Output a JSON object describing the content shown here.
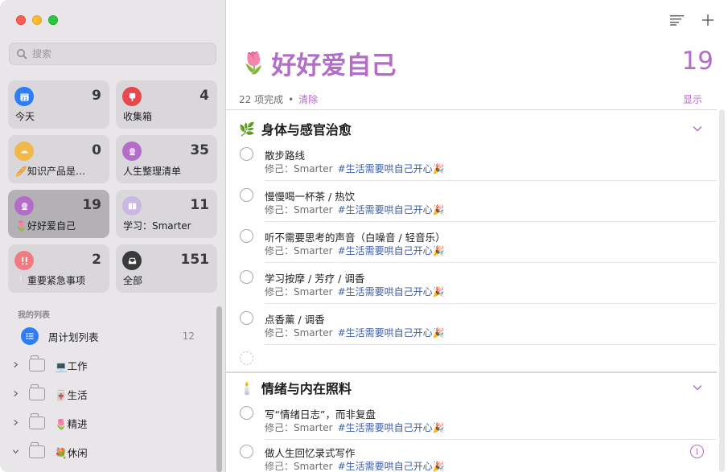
{
  "sidebar": {
    "search_placeholder": "搜索",
    "tiles": [
      {
        "label": "今天",
        "count": "9",
        "icon": "calendar-icon",
        "color": "#2f7df6",
        "glyph": "21"
      },
      {
        "label": "收集箱",
        "count": "4",
        "icon": "inbox-icon",
        "color": "#e5484d",
        "glyph": "📮"
      },
      {
        "label": "🥖知识产品是…",
        "count": "0",
        "icon": "bread-icon",
        "color": "#f0b84a",
        "glyph": "🥐"
      },
      {
        "label": "人生整理清单",
        "count": "35",
        "icon": "crystal-ball-icon",
        "color": "#b46cc9",
        "glyph": "🔮"
      },
      {
        "label": "🌷好好爱自己",
        "count": "19",
        "icon": "crystal-ball-icon",
        "color": "#b46cc9",
        "glyph": "🔮"
      },
      {
        "label": "学习：Smarter",
        "count": "11",
        "icon": "book-icon",
        "color": "#c9b8e6",
        "glyph": "📖"
      },
      {
        "label": "❕重要紧急事项",
        "count": "2",
        "icon": "exclamation-icon",
        "color": "#f27a83",
        "glyph": "‼"
      },
      {
        "label": "全部",
        "count": "151",
        "icon": "tray-icon",
        "color": "#3a3a3c",
        "glyph": "⌂"
      }
    ],
    "section_title": "我的列表",
    "lists": [
      {
        "name": "周计划列表",
        "count": "12"
      },
      {
        "name": "💻工作"
      },
      {
        "name": "🀄生活"
      },
      {
        "name": "🌷精进"
      },
      {
        "name": "💐休闲"
      }
    ]
  },
  "main": {
    "title_emoji": "🌷",
    "title": "好好爱自己",
    "count": "19",
    "completed": "22 项完成",
    "dot": "•",
    "clear": "清除",
    "show": "显示",
    "groups": [
      {
        "emoji": "🌿",
        "title": "身体与感官治愈",
        "tasks": [
          {
            "title": "散步路线",
            "note": "修己：Smarter",
            "tag": "#生活需要哄自己开心🎉"
          },
          {
            "title": "慢慢喝一杯茶 / 热饮",
            "note": "修己：Smarter",
            "tag": "#生活需要哄自己开心🎉"
          },
          {
            "title": "听不需要思考的声音（白噪音 / 轻音乐）",
            "note": "修己：Smarter",
            "tag": "#生活需要哄自己开心🎉"
          },
          {
            "title": "学习按摩 / 芳疗 / 调香",
            "note": "修己：Smarter",
            "tag": "#生活需要哄自己开心🎉"
          },
          {
            "title": "点香薰 / 调香",
            "note": "修己：Smarter",
            "tag": "#生活需要哄自己开心🎉"
          }
        ]
      },
      {
        "emoji": "🕯️",
        "title": "情绪与内在照料",
        "tasks": [
          {
            "title": "写“情绪日志”，而非复盘",
            "note": "修己：Smarter",
            "tag": "#生活需要哄自己开心🎉"
          },
          {
            "title": "做人生回忆录式写作",
            "note": "修己：Smarter",
            "tag": "#生活需要哄自己开心🎉"
          }
        ]
      }
    ]
  }
}
